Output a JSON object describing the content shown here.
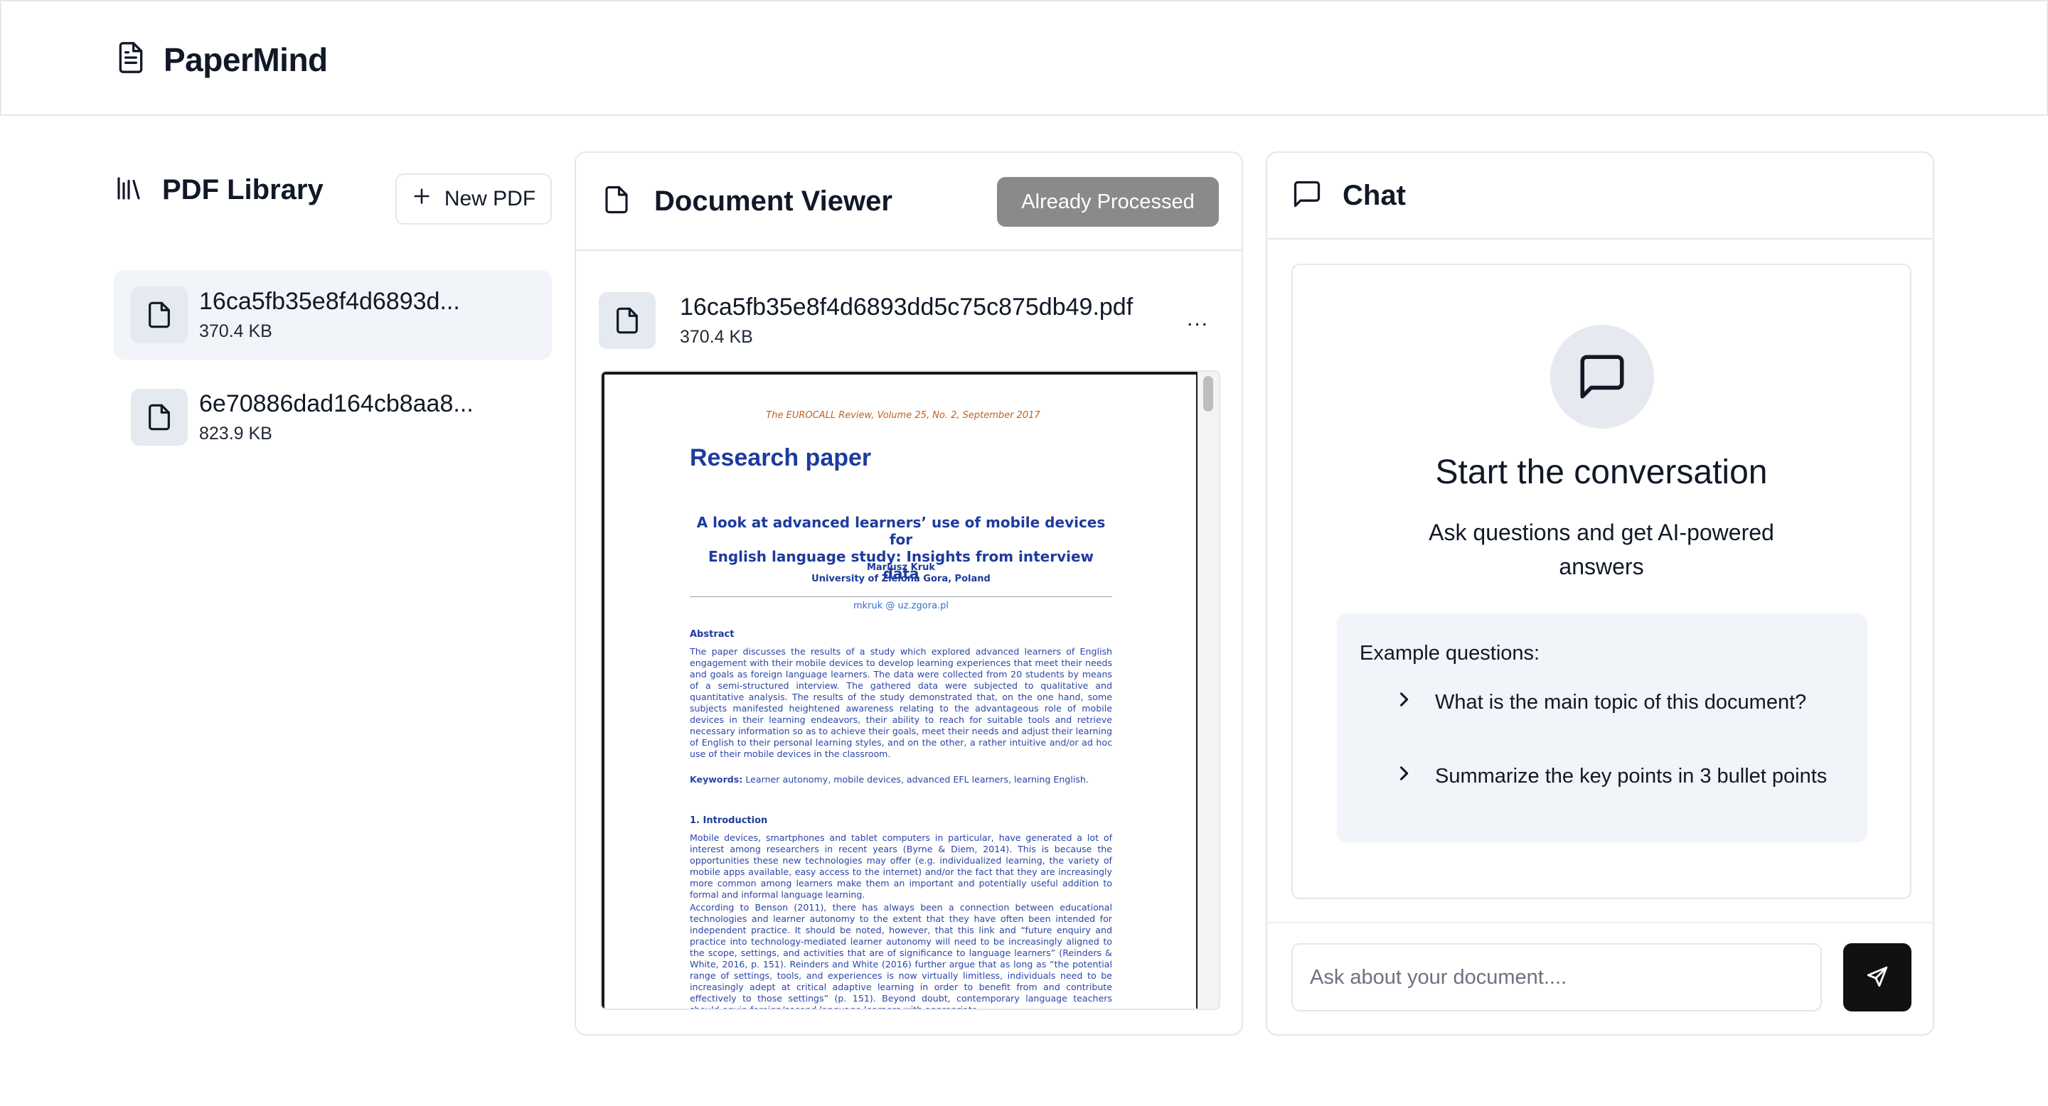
{
  "app": {
    "name": "PaperMind"
  },
  "library": {
    "title": "PDF Library",
    "new_button": "New PDF",
    "files": [
      {
        "name": "16ca5fb35e8f4d6893d...",
        "size": "370.4 KB",
        "active": true
      },
      {
        "name": "6e70886dad164cb8aa8...",
        "size": "823.9 KB",
        "active": false
      }
    ]
  },
  "viewer": {
    "title": "Document Viewer",
    "status_button": "Already Processed",
    "file_name": "16ca5fb35e8f4d6893dd5c75c875db49.pdf",
    "file_size": "370.4 KB",
    "more_label": "...",
    "page": {
      "journal_prefix": "The EUROCALL Review",
      "journal_suffix": ", Volume 25, No. 2, September 2017",
      "paper_type": "Research paper",
      "title_line1": "A look at advanced learners’ use of mobile devices for",
      "title_line2": "English language study: Insights from interview data",
      "author": "Mariusz Kruk",
      "affiliation": "University of Zielona Gora, Poland",
      "email": "mkruk @ uz.zgora.pl",
      "abstract_heading": "Abstract",
      "abstract_text": "The paper discusses the results of a study which explored advanced learners of English engagement with their mobile devices to develop learning experiences that meet their needs and goals as foreign language learners. The data were collected from 20 students by means of a semi-structured interview. The gathered data were subjected to qualitative and quantitative analysis. The results of the study demonstrated that, on the one hand, some subjects manifested heightened awareness relating to the advantageous role of mobile devices in their learning endeavors, their ability to reach for suitable tools and retrieve necessary information so as to achieve their goals, meet their needs and adjust their learning of English to their personal learning styles, and on the other, a rather intuitive and/or ad hoc use of their mobile devices in the classroom.",
      "keywords_label": "Keywords:",
      "keywords_text": " Learner autonomy, mobile devices, advanced EFL learners, learning English.",
      "intro_heading": "1. Introduction",
      "intro_p1": "Mobile devices, smartphones and tablet computers in particular, have generated a lot of interest among researchers in recent years (Byrne & Diem, 2014). This is because the opportunities these new technologies may offer (e.g. individualized learning, the variety of mobile apps available, easy access to the internet) and/or the fact that they are increasingly more common among learners make them an important and potentially useful addition to formal and informal language learning.",
      "intro_p2": "According to Benson (2011), there has always been a connection between educational technologies and learner autonomy to the extent that they have often been intended for independent practice. It should be noted, however, that this link and “future enquiry and practice into technology-mediated learner autonomy will need to be increasingly aligned to the scope, settings, and activities that are of significance to language learners” (Reinders & White, 2016, p. 151). Reinders and White (2016) further argue that as long as “the potential range of settings, tools, and experiences is now virtually limitless, individuals need to be increasingly adept at critical adaptive learning in order to benefit from and contribute effectively to those settings” (p. 151). Beyond doubt, contemporary language teachers should equip foreign/second language learners with appropriate"
    }
  },
  "chat": {
    "title": "Chat",
    "empty_title": "Start the conversation",
    "empty_subtitle": "Ask questions and get AI-powered answers",
    "examples_label": "Example questions:",
    "examples": [
      "What is the main topic of this document?",
      "Summarize the key points in 3 bullet points"
    ],
    "input_placeholder": "Ask about your document...."
  },
  "colors": {
    "accent": "#111111",
    "status_button": "#8a8a8a",
    "active_item": "#f1f4f8",
    "paper_blue": "#1d3b9e",
    "journal_orange": "#c2601a"
  },
  "icons": {
    "brand": "document-text-icon",
    "library": "library-icon",
    "new": "plus-icon",
    "file": "file-icon",
    "chat": "message-square-icon",
    "example": "chevron-right-icon",
    "send": "send-icon"
  }
}
